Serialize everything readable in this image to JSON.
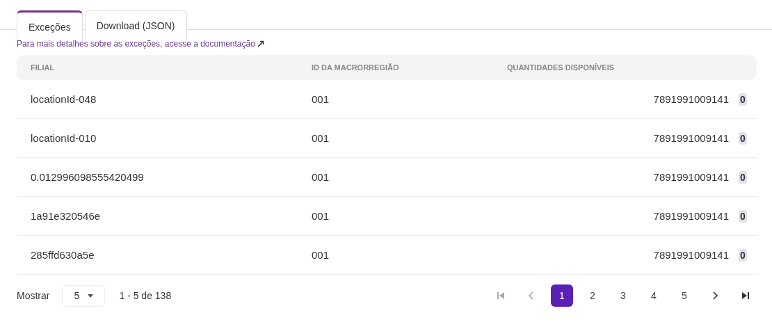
{
  "tabs": [
    {
      "label": "Exceções",
      "selected": true
    },
    {
      "label": "Download (JSON)",
      "selected": false
    }
  ],
  "doc_link": {
    "text": "Para mais detalhes sobre as exceções, acesse a documentação"
  },
  "table": {
    "columns": [
      "FILIAL",
      "ID DA MACRORREGIÃO",
      "QUANTIDADES DISPONÍVEIS"
    ],
    "rows": [
      {
        "filial": "locationId-048",
        "macro": "001",
        "code": "7891991009141",
        "qty": "0"
      },
      {
        "filial": "locationId-010",
        "macro": "001",
        "code": "7891991009141",
        "qty": "0"
      },
      {
        "filial": "0.012996098555420499",
        "macro": "001",
        "code": "7891991009141",
        "qty": "0"
      },
      {
        "filial": "1a91e320546e",
        "macro": "001",
        "code": "7891991009141",
        "qty": "0"
      },
      {
        "filial": "285ffd630a5e",
        "macro": "001",
        "code": "7891991009141",
        "qty": "0"
      }
    ]
  },
  "pagination": {
    "show_label": "Mostrar",
    "page_size": "5",
    "range": "1 - 5 de 138",
    "first_disabled": true,
    "prev_disabled": true,
    "next_disabled": false,
    "last_disabled": false,
    "pages": [
      {
        "label": "1",
        "selected": true
      },
      {
        "label": "2",
        "selected": false
      },
      {
        "label": "3",
        "selected": false
      },
      {
        "label": "4",
        "selected": false
      },
      {
        "label": "5",
        "selected": false
      }
    ]
  }
}
